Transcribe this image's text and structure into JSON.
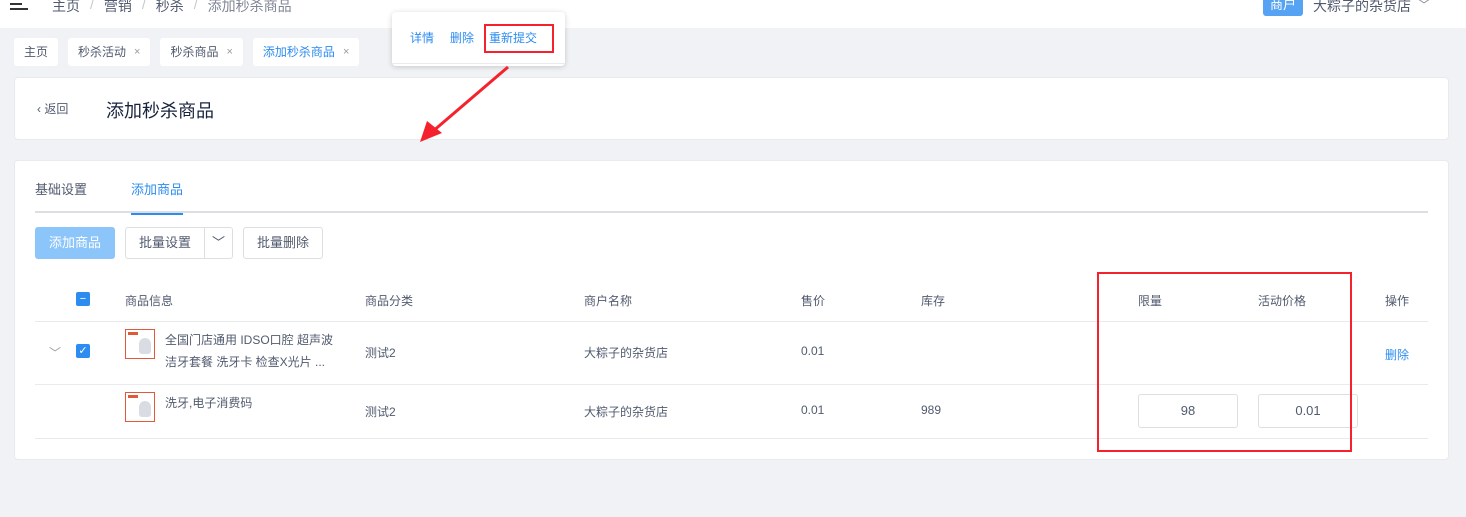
{
  "header": {
    "breadcrumbs": [
      "主页",
      "营销",
      "秒杀",
      "添加秒杀商品"
    ],
    "role_badge": "商户",
    "shop_name": "大粽子的杂货店"
  },
  "tags": [
    {
      "label": "主页",
      "closable": false,
      "active": false
    },
    {
      "label": "秒杀活动",
      "closable": true,
      "active": false
    },
    {
      "label": "秒杀商品",
      "closable": true,
      "active": false
    },
    {
      "label": "添加秒杀商品",
      "closable": true,
      "active": true
    }
  ],
  "popover": {
    "detail": "详情",
    "delete": "删除",
    "resubmit": "重新提交"
  },
  "page": {
    "back": "返回",
    "title": "添加秒杀商品"
  },
  "tabs": [
    "基础设置",
    "添加商品"
  ],
  "toolbar": {
    "add": "添加商品",
    "batch_set": "批量设置",
    "batch_delete": "批量删除"
  },
  "table": {
    "columns": [
      "商品信息",
      "商品分类",
      "商户名称",
      "售价",
      "库存",
      "限量",
      "活动价格",
      "操作"
    ],
    "rows": [
      {
        "name_line1": "全国门店通用 IDSO口腔 超声波",
        "name_line2": "洁牙套餐 洗牙卡 检查X光片 ...",
        "category": "测试2",
        "merchant": "大粽子的杂货店",
        "price": "0.01",
        "stock": "",
        "action": "删除"
      },
      {
        "name_line1": "洗牙,电子消费码",
        "category": "测试2",
        "merchant": "大粽子的杂货店",
        "price": "0.01",
        "stock": "989",
        "limit": "98",
        "activity_price": "0.01"
      }
    ]
  },
  "colors": {
    "accent": "#2d8cf0",
    "annotation_red": "#f5222d"
  }
}
